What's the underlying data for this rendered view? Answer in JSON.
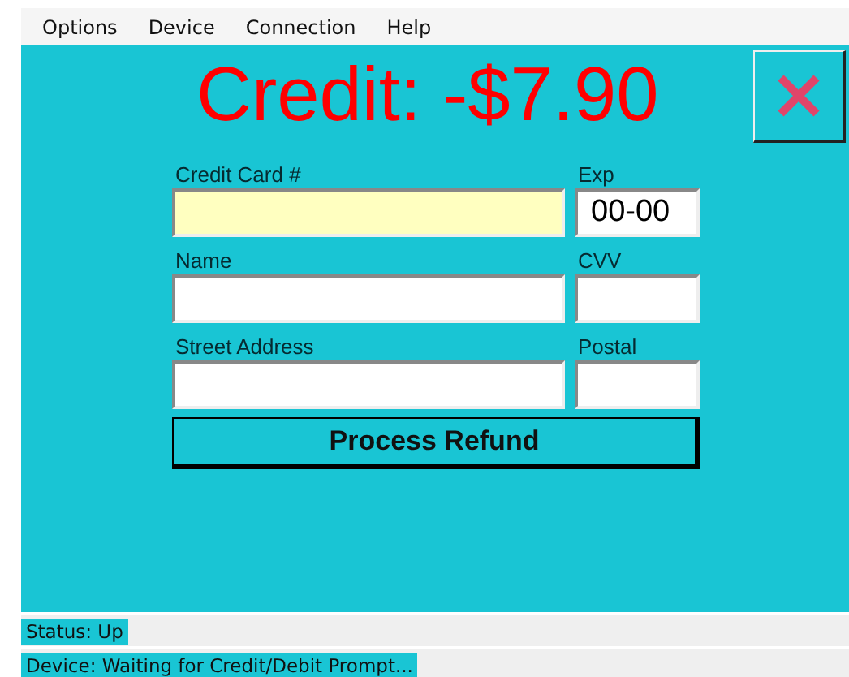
{
  "menu": [
    "Options",
    "Device",
    "Connection",
    "Help"
  ],
  "title": "Credit: -$7.90",
  "fields": [
    {
      "kind": "wide",
      "label": "Credit Card #",
      "focused": true
    },
    {
      "kind": "narrow",
      "label": "Exp",
      "value": "00-00",
      "focused": false
    },
    {
      "kind": "wide",
      "label": "Name",
      "focused": false
    },
    {
      "kind": "narrow",
      "label": "CVV",
      "focused": false
    },
    {
      "kind": "wide",
      "label": "Street Address",
      "focused": false
    },
    {
      "kind": "narrow",
      "label": "Postal",
      "focused": false
    }
  ],
  "action_button": "Process Refund",
  "status_lines": [
    "Status: Up",
    "Device: Waiting for Credit/Debit Prompt..."
  ]
}
